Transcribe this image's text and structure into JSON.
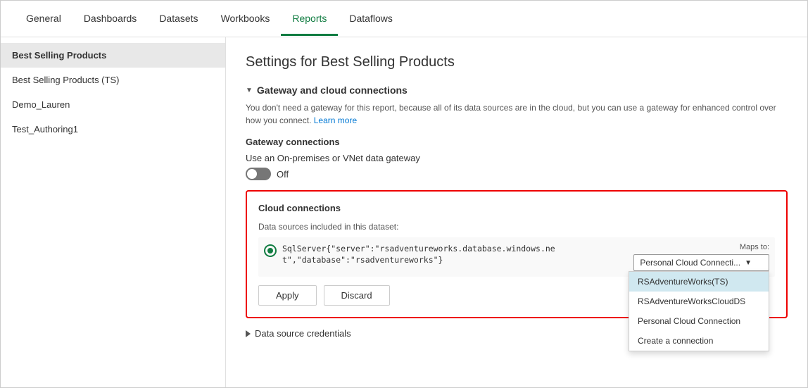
{
  "nav": {
    "items": [
      {
        "label": "General",
        "active": false
      },
      {
        "label": "Dashboards",
        "active": false
      },
      {
        "label": "Datasets",
        "active": false
      },
      {
        "label": "Workbooks",
        "active": false
      },
      {
        "label": "Reports",
        "active": true
      },
      {
        "label": "Dataflows",
        "active": false
      }
    ]
  },
  "sidebar": {
    "items": [
      {
        "label": "Best Selling Products",
        "active": true
      },
      {
        "label": "Best Selling Products (TS)",
        "active": false
      },
      {
        "label": "Demo_Lauren",
        "active": false
      },
      {
        "label": "Test_Authoring1",
        "active": false
      }
    ]
  },
  "main": {
    "page_title": "Settings for Best Selling Products",
    "gateway_section": {
      "title": "Gateway and cloud connections",
      "description": "You don't need a gateway for this report, because all of its data sources are in the cloud, but you can use a gateway for enhanced control over how you connect.",
      "learn_more_label": "Learn more",
      "gateway_connections_title": "Gateway connections",
      "gateway_toggle_label": "Use an On-premises or VNet data gateway",
      "toggle_state": "Off"
    },
    "cloud_connections": {
      "title": "Cloud connections",
      "datasources_label": "Data sources included in this dataset:",
      "datasource_text_line1": "SqlServer{\"server\":\"rsadventureworks.database.windows.ne",
      "datasource_text_line2": "t\",\"database\":\"rsadventureworks\"}",
      "maps_to_label": "Maps to:",
      "selected_option": "Personal Cloud Connecti...",
      "dropdown_options": [
        {
          "label": "RSAdventureWorks(TS)",
          "selected": true
        },
        {
          "label": "RSAdventureWorksCloudDS",
          "selected": false
        },
        {
          "label": "Personal Cloud Connection",
          "selected": false
        },
        {
          "label": "Create a connection",
          "selected": false
        }
      ],
      "apply_label": "Apply",
      "discard_label": "Discard"
    },
    "datasource_credentials": {
      "label": "Data source credentials"
    }
  }
}
